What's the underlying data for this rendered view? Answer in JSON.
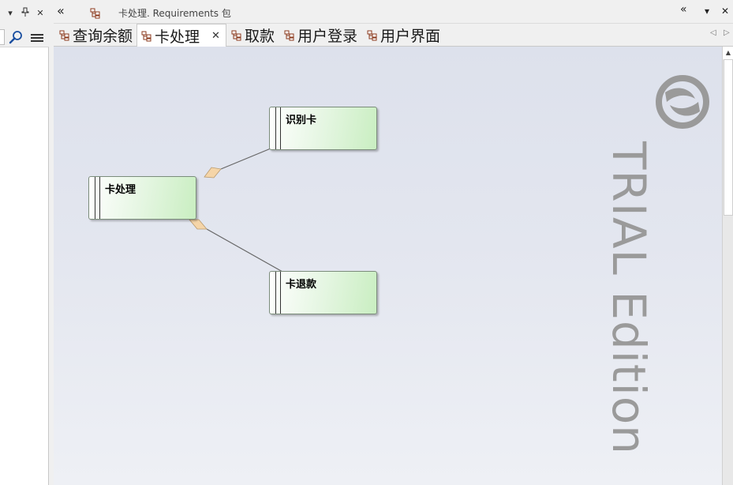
{
  "left_panel": {
    "buttons": {
      "dropdown": "▾",
      "pin": "ꟸ",
      "close": "✕"
    },
    "toolbar": {
      "search_icon": "search-icon",
      "menu_icon": "hamburger-menu-icon"
    }
  },
  "breadcrumb": {
    "back": "«",
    "path": "卡处理.  Requirements 包",
    "right_back": "«",
    "dropdown": "▾",
    "close": "✕"
  },
  "tabs": [
    {
      "label": "查询余额",
      "active": false
    },
    {
      "label": "卡处理",
      "active": true,
      "close": "✕"
    },
    {
      "label": "取款",
      "active": false
    },
    {
      "label": "用户登录",
      "active": false
    },
    {
      "label": "用户界面",
      "active": false
    }
  ],
  "tab_scroll": {
    "left": "◁",
    "right": "▷"
  },
  "diagram": {
    "elements": [
      {
        "id": "card-processing",
        "name": "卡处理"
      },
      {
        "id": "identify-card",
        "name": "识别卡"
      },
      {
        "id": "eject-card",
        "name": "卡退款"
      }
    ],
    "watermark": "TRIAL Edition"
  },
  "colors": {
    "element_fill_end": "#c9eec1",
    "canvas_top": "#dde1ec",
    "aggregation_diamond": "#f5d5a8",
    "watermark": "#9a9a9a"
  }
}
